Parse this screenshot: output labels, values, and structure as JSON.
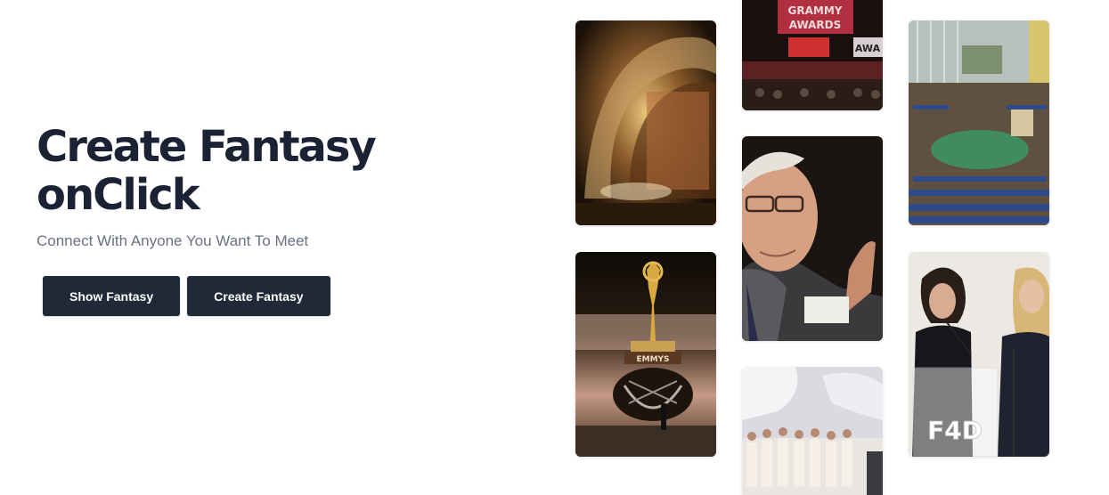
{
  "hero": {
    "title_line1": "Create Fantasy",
    "title_line2": "onClick",
    "subtitle": "Connect With Anyone You Want To Meet",
    "show_button_label": "Show Fantasy",
    "create_button_label": "Create Fantasy"
  },
  "colors": {
    "heading": "#1a2233",
    "subtitle": "#6b7280",
    "button_bg": "#1f2937",
    "button_text": "#ffffff"
  },
  "gallery": {
    "grammy_screen_line1": "GRAMMY",
    "grammy_screen_line2": "AWARDS",
    "grammy_side_text": "AWA",
    "emmys_label": "EMMYS",
    "podium_logo": "F4D"
  }
}
